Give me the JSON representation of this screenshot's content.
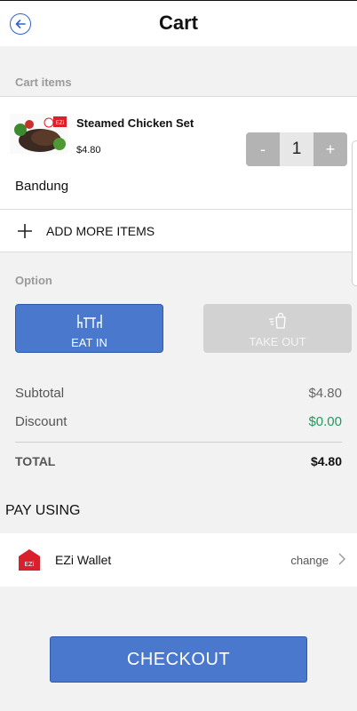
{
  "header": {
    "title": "Cart",
    "back_icon": "arrow-left-circle-icon"
  },
  "cart": {
    "section_label": "Cart items",
    "items": [
      {
        "name": "Steamed Chicken Set",
        "price": "$4.80",
        "quantity": "1",
        "location": "Bandung",
        "thumb_badge": "EZi"
      }
    ],
    "minus_label": "-",
    "plus_label": "+",
    "add_more_label": "ADD MORE ITEMS"
  },
  "options": {
    "section_label": "Option",
    "eat_in": {
      "label": "EAT IN",
      "icon": "dining-table-icon",
      "selected": true
    },
    "take_out": {
      "label": "TAKE OUT",
      "icon": "takeout-bag-icon",
      "selected": false
    }
  },
  "summary": {
    "subtotal_label": "Subtotal",
    "subtotal_value": "$4.80",
    "discount_label": "Discount",
    "discount_value": "$0.00",
    "total_label": "TOTAL",
    "total_value": "$4.80"
  },
  "payment": {
    "heading": "PAY USING",
    "method_name": "EZi Wallet",
    "method_icon_text": "EZi",
    "change_label": "change"
  },
  "checkout_label": "CHECKOUT",
  "colors": {
    "accent": "#4a78cc",
    "discount_green": "#1f9a5a",
    "disabled": "#d2d2d2",
    "wallet_red": "#d8212b"
  }
}
